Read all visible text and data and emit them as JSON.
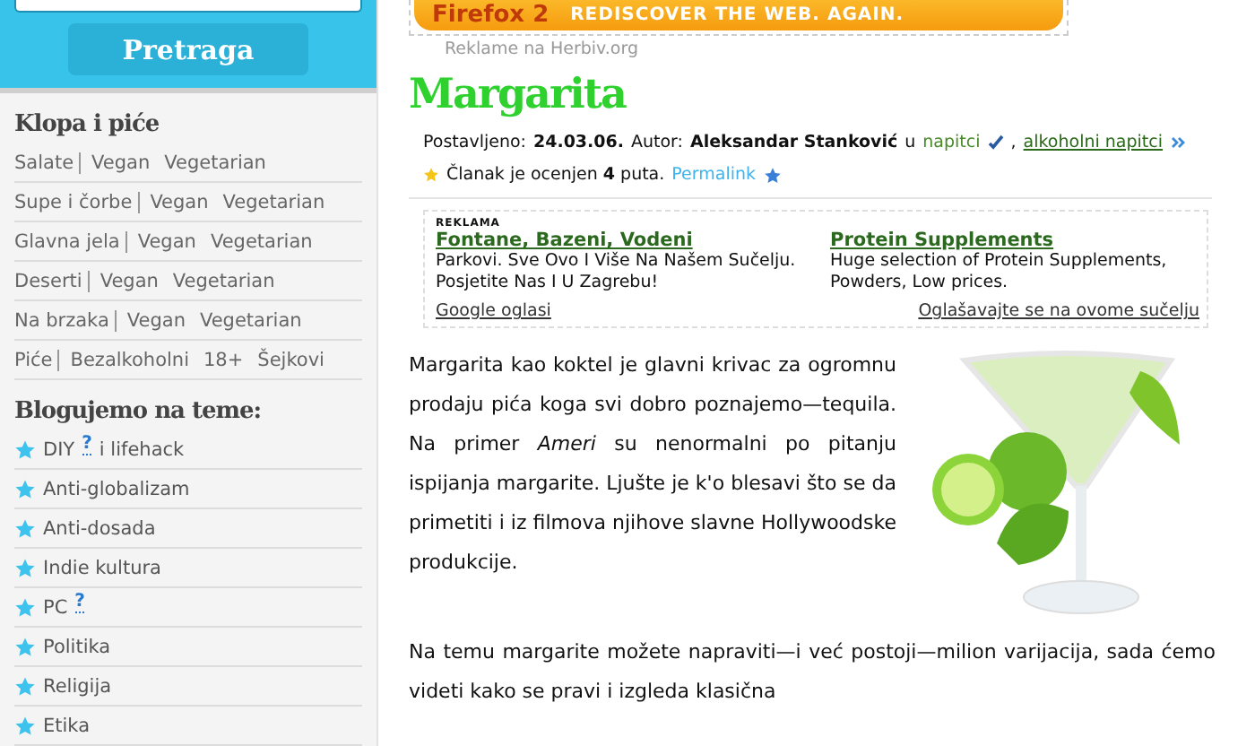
{
  "sidebar": {
    "search": {
      "button": "Pretraga"
    },
    "food_section": {
      "title": "Klopa i piće",
      "categories": [
        {
          "label": "Salate",
          "links": [
            "Vegan",
            "Vegetarian"
          ]
        },
        {
          "label": "Supe i čorbe",
          "links": [
            "Vegan",
            "Vegetarian"
          ]
        },
        {
          "label": "Glavna jela",
          "links": [
            "Vegan",
            "Vegetarian"
          ]
        },
        {
          "label": "Deserti",
          "links": [
            "Vegan",
            "Vegetarian"
          ]
        },
        {
          "label": "Na brzaka",
          "links": [
            "Vegan",
            "Vegetarian"
          ]
        },
        {
          "label": "Piće",
          "links": [
            "Bezalkoholni",
            "18+",
            "Šejkovi"
          ]
        }
      ]
    },
    "topics_section": {
      "title": "Blogujemo na teme:",
      "items": [
        {
          "label": "DIY",
          "help": "?",
          "after": "i lifehack"
        },
        {
          "label": "Anti-globalizam"
        },
        {
          "label": "Anti-dosada"
        },
        {
          "label": "Indie kultura"
        },
        {
          "label": "PC",
          "help": "?"
        },
        {
          "label": "Politika"
        },
        {
          "label": "Religija"
        },
        {
          "label": "Etika"
        }
      ]
    }
  },
  "main": {
    "banner": {
      "brand": "Firefox 2",
      "slogan": "REDISCOVER THE WEB. AGAIN."
    },
    "ad_caption": "Reklame na Herbiv.org",
    "article": {
      "title": "Margarita",
      "meta": {
        "posted_label": "Postavljeno:",
        "date": "24.03.06.",
        "author_label": "Autor:",
        "author": "Aleksandar Stanković",
        "in": "u",
        "category": "napitci",
        "separator": ",",
        "category_2": "alkoholni napitci"
      },
      "rating": {
        "text": "Članak je ocenjen **4** puta.",
        "permalink": "Permalink"
      },
      "ads": {
        "label": "REKLAMA",
        "items": [
          {
            "title": "Fontane, Bazeni, Vodeni",
            "text": "Parkovi. Sve Ovo I Više Na Našem Sučelju. Posjetite Nas I U Zagrebu!"
          },
          {
            "title": "Protein Supplements",
            "text": "Huge selection of Protein Supplements, Powders, Low prices."
          }
        ],
        "footer_left": "Google oglasi",
        "footer_right": "Oglašavajte se na ovome sučelju"
      },
      "paragraphs": [
        "Margarita kao koktel je glavni krivac za ogromnu prodaju pića koga svi dobro poznajemo—tequila. Na primer *Ameri* su nenormalni po pitanju ispijanja margarite. Ljušte je k'o blesavi što se da primetiti i iz filmova njihove slavne Hollywoodske produkcije.",
        "Na temu margarite možete napraviti—i već postoji—milion varijacija, sada ćemo videti kako se pravi i izgleda klasična"
      ]
    }
  }
}
